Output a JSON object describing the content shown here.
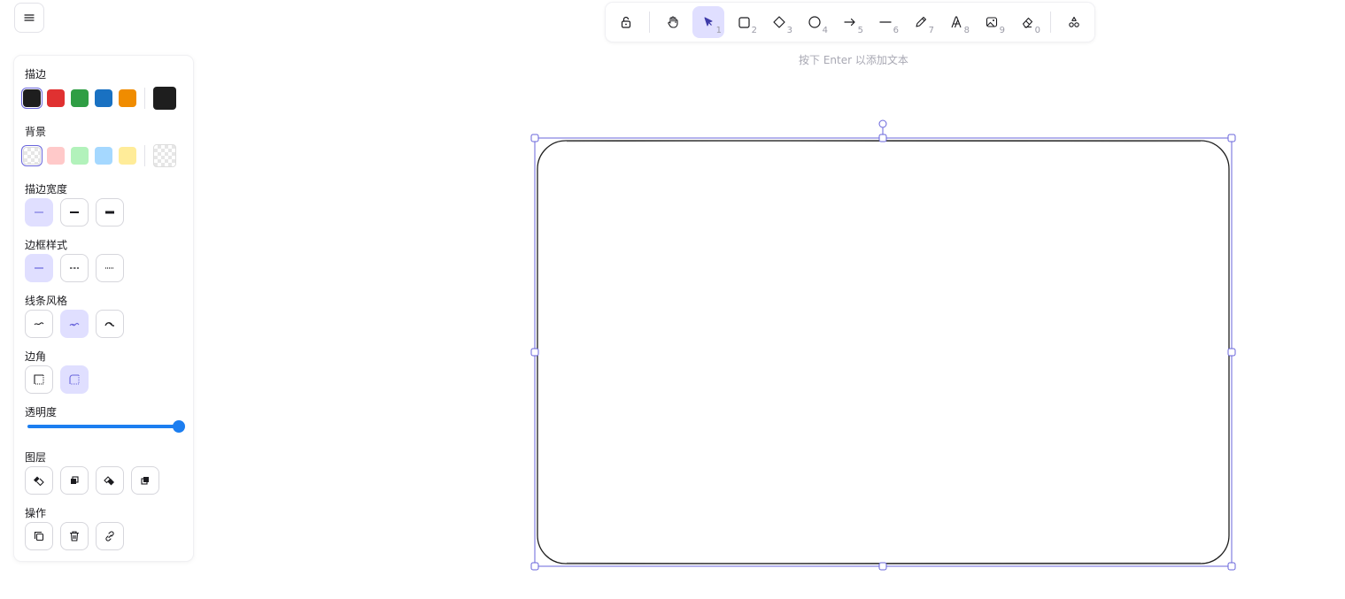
{
  "hint": "按下 Enter 以添加文本",
  "panel": {
    "stroke_label": "描边",
    "background_label": "背景",
    "stroke_width_label": "描边宽度",
    "stroke_style_label": "边框样式",
    "sloppiness_label": "线条风格",
    "edges_label": "边角",
    "opacity_label": "透明度",
    "opacity_value": 100,
    "layers_label": "图层",
    "actions_label": "操作",
    "stroke_colors": [
      "#1e1e1e",
      "#e03131",
      "#2f9e44",
      "#1971c2",
      "#f08c00"
    ],
    "stroke_current": "#1e1e1e",
    "background_colors": [
      "transparent",
      "#ffc9c9",
      "#b2f2bb",
      "#a5d8ff",
      "#ffec99"
    ],
    "background_current": "transparent"
  },
  "toolbar": {
    "tools": [
      {
        "name": "lock-tool",
        "icon": "lock-icon",
        "key": ""
      },
      {
        "name": "hand-tool",
        "icon": "hand-icon",
        "key": ""
      },
      {
        "name": "selection-tool",
        "icon": "pointer-icon",
        "key": "1",
        "active": true
      },
      {
        "name": "rectangle-tool",
        "icon": "square-icon",
        "key": "2"
      },
      {
        "name": "diamond-tool",
        "icon": "diamond-icon",
        "key": "3"
      },
      {
        "name": "ellipse-tool",
        "icon": "circle-icon",
        "key": "4"
      },
      {
        "name": "arrow-tool",
        "icon": "arrow-icon",
        "key": "5"
      },
      {
        "name": "line-tool",
        "icon": "line-icon",
        "key": "6"
      },
      {
        "name": "draw-tool",
        "icon": "pencil-icon",
        "key": "7"
      },
      {
        "name": "text-tool",
        "icon": "text-icon",
        "key": "8"
      },
      {
        "name": "image-tool",
        "icon": "image-icon",
        "key": "9"
      },
      {
        "name": "eraser-tool",
        "icon": "eraser-icon",
        "key": "0"
      },
      {
        "name": "more-tools",
        "icon": "shapes-icon",
        "key": ""
      }
    ]
  },
  "colors": {
    "accent": "#6965db",
    "accent_light": "#e0dfff",
    "slider": "#1c7ef0"
  }
}
